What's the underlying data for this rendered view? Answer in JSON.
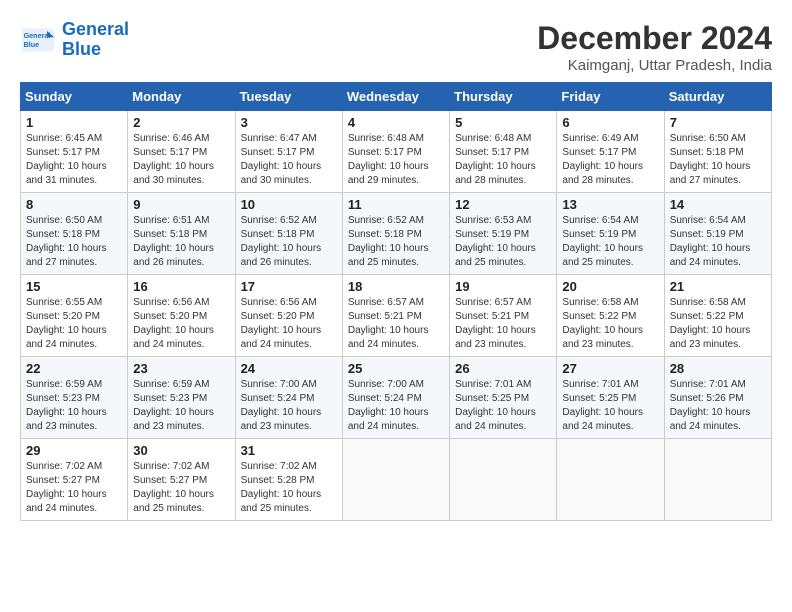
{
  "header": {
    "logo_line1": "General",
    "logo_line2": "Blue",
    "month": "December 2024",
    "location": "Kaimganj, Uttar Pradesh, India"
  },
  "weekdays": [
    "Sunday",
    "Monday",
    "Tuesday",
    "Wednesday",
    "Thursday",
    "Friday",
    "Saturday"
  ],
  "weeks": [
    [
      {
        "day": "1",
        "info": "Sunrise: 6:45 AM\nSunset: 5:17 PM\nDaylight: 10 hours\nand 31 minutes."
      },
      {
        "day": "2",
        "info": "Sunrise: 6:46 AM\nSunset: 5:17 PM\nDaylight: 10 hours\nand 30 minutes."
      },
      {
        "day": "3",
        "info": "Sunrise: 6:47 AM\nSunset: 5:17 PM\nDaylight: 10 hours\nand 30 minutes."
      },
      {
        "day": "4",
        "info": "Sunrise: 6:48 AM\nSunset: 5:17 PM\nDaylight: 10 hours\nand 29 minutes."
      },
      {
        "day": "5",
        "info": "Sunrise: 6:48 AM\nSunset: 5:17 PM\nDaylight: 10 hours\nand 28 minutes."
      },
      {
        "day": "6",
        "info": "Sunrise: 6:49 AM\nSunset: 5:17 PM\nDaylight: 10 hours\nand 28 minutes."
      },
      {
        "day": "7",
        "info": "Sunrise: 6:50 AM\nSunset: 5:18 PM\nDaylight: 10 hours\nand 27 minutes."
      }
    ],
    [
      {
        "day": "8",
        "info": "Sunrise: 6:50 AM\nSunset: 5:18 PM\nDaylight: 10 hours\nand 27 minutes."
      },
      {
        "day": "9",
        "info": "Sunrise: 6:51 AM\nSunset: 5:18 PM\nDaylight: 10 hours\nand 26 minutes."
      },
      {
        "day": "10",
        "info": "Sunrise: 6:52 AM\nSunset: 5:18 PM\nDaylight: 10 hours\nand 26 minutes."
      },
      {
        "day": "11",
        "info": "Sunrise: 6:52 AM\nSunset: 5:18 PM\nDaylight: 10 hours\nand 25 minutes."
      },
      {
        "day": "12",
        "info": "Sunrise: 6:53 AM\nSunset: 5:19 PM\nDaylight: 10 hours\nand 25 minutes."
      },
      {
        "day": "13",
        "info": "Sunrise: 6:54 AM\nSunset: 5:19 PM\nDaylight: 10 hours\nand 25 minutes."
      },
      {
        "day": "14",
        "info": "Sunrise: 6:54 AM\nSunset: 5:19 PM\nDaylight: 10 hours\nand 24 minutes."
      }
    ],
    [
      {
        "day": "15",
        "info": "Sunrise: 6:55 AM\nSunset: 5:20 PM\nDaylight: 10 hours\nand 24 minutes."
      },
      {
        "day": "16",
        "info": "Sunrise: 6:56 AM\nSunset: 5:20 PM\nDaylight: 10 hours\nand 24 minutes."
      },
      {
        "day": "17",
        "info": "Sunrise: 6:56 AM\nSunset: 5:20 PM\nDaylight: 10 hours\nand 24 minutes."
      },
      {
        "day": "18",
        "info": "Sunrise: 6:57 AM\nSunset: 5:21 PM\nDaylight: 10 hours\nand 24 minutes."
      },
      {
        "day": "19",
        "info": "Sunrise: 6:57 AM\nSunset: 5:21 PM\nDaylight: 10 hours\nand 23 minutes."
      },
      {
        "day": "20",
        "info": "Sunrise: 6:58 AM\nSunset: 5:22 PM\nDaylight: 10 hours\nand 23 minutes."
      },
      {
        "day": "21",
        "info": "Sunrise: 6:58 AM\nSunset: 5:22 PM\nDaylight: 10 hours\nand 23 minutes."
      }
    ],
    [
      {
        "day": "22",
        "info": "Sunrise: 6:59 AM\nSunset: 5:23 PM\nDaylight: 10 hours\nand 23 minutes."
      },
      {
        "day": "23",
        "info": "Sunrise: 6:59 AM\nSunset: 5:23 PM\nDaylight: 10 hours\nand 23 minutes."
      },
      {
        "day": "24",
        "info": "Sunrise: 7:00 AM\nSunset: 5:24 PM\nDaylight: 10 hours\nand 23 minutes."
      },
      {
        "day": "25",
        "info": "Sunrise: 7:00 AM\nSunset: 5:24 PM\nDaylight: 10 hours\nand 24 minutes."
      },
      {
        "day": "26",
        "info": "Sunrise: 7:01 AM\nSunset: 5:25 PM\nDaylight: 10 hours\nand 24 minutes."
      },
      {
        "day": "27",
        "info": "Sunrise: 7:01 AM\nSunset: 5:25 PM\nDaylight: 10 hours\nand 24 minutes."
      },
      {
        "day": "28",
        "info": "Sunrise: 7:01 AM\nSunset: 5:26 PM\nDaylight: 10 hours\nand 24 minutes."
      }
    ],
    [
      {
        "day": "29",
        "info": "Sunrise: 7:02 AM\nSunset: 5:27 PM\nDaylight: 10 hours\nand 24 minutes."
      },
      {
        "day": "30",
        "info": "Sunrise: 7:02 AM\nSunset: 5:27 PM\nDaylight: 10 hours\nand 25 minutes."
      },
      {
        "day": "31",
        "info": "Sunrise: 7:02 AM\nSunset: 5:28 PM\nDaylight: 10 hours\nand 25 minutes."
      },
      {
        "day": "",
        "info": ""
      },
      {
        "day": "",
        "info": ""
      },
      {
        "day": "",
        "info": ""
      },
      {
        "day": "",
        "info": ""
      }
    ]
  ]
}
